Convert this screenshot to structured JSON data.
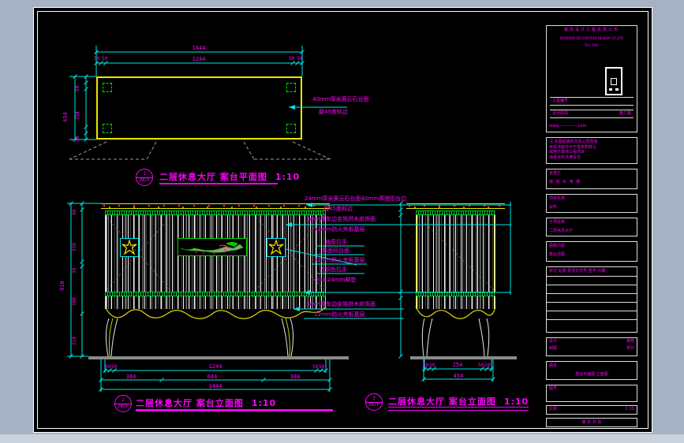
{
  "plan": {
    "bubble": {
      "number": "1",
      "floor": "2W/F"
    },
    "title": "二层休息大厅 案台平面图",
    "scale": "1:10",
    "dims": {
      "overall_w": "1444",
      "inner_w": "1244",
      "edge": "50",
      "overall_d": "454",
      "inner_d": "254"
    },
    "note_line1": "40mm厚米黄云石台面",
    "note_line2": "磨45度斜边"
  },
  "front": {
    "bubble": {
      "number": "2",
      "floor": "2W/F"
    },
    "title": "二层休息大厅 案台立面图",
    "scale": "1:10",
    "dims": {
      "row1_center": "1244",
      "edge": "50",
      "row2": [
        "384",
        "644",
        "384"
      ],
      "row3": "1444",
      "left": [
        "40",
        "330",
        "30",
        "300",
        "210"
      ],
      "left_overall": "910"
    },
    "annotations": [
      "24mm厚米黄云石台面40mm厚随形台边",
      "磨45度斜边",
      "3mm厚车边金箔拼木皮饰面",
      "12mm防火夹板基层",
      "抽屉拉手",
      "饰面同台面",
      "12mm防火夹板基层",
      "古铜色拉手",
      "24×24mm脚垫",
      "3mm厚车边金箔拼木皮饰面",
      "12mm防火夹板基层"
    ]
  },
  "side": {
    "bubble": {
      "number": "3",
      "floor": "2W/F"
    },
    "title": "二层休息大厅 案台立面图",
    "scale": "1:10",
    "dims": {
      "row1_center": "254",
      "edge": "50",
      "row2": "454"
    }
  },
  "title_block": {
    "company_cn": "装饰设计工程有限公司",
    "company_en": "INTERIOR DECORATION DESIGN CO.,LTD",
    "contact": "TEL:          FAX:",
    "field1_label": "工程编号",
    "field1_value": "",
    "field2_label": "设计阶段",
    "field2_value": "施工图",
    "website": "www.------------.com",
    "notes": [
      "注:本图纸版权归本公司所有",
      "未经书面许可不得复制转让",
      "或用于其他工程项目",
      "违者追究法律责任"
    ],
    "huiqian_label": "会签栏",
    "huiqian_cols": "建  结  水  电  暖",
    "project_label": "项目名称",
    "project_value": "会所",
    "sub_label": "子项名称",
    "sub_value": "二层休息大厅",
    "content_label": "图纸内容",
    "content_value": "案台详图",
    "rev_header": "标记 处数 更改文件号 签字 日期",
    "design_label": "设计",
    "check_label": "审核",
    "draw_label": "制图",
    "proof_label": "校对",
    "drawing_name_label": "图名",
    "drawing_name": "案台平面图 立面图",
    "drawing_no_label": "图号",
    "drawing_no": "",
    "scale_label": "比例",
    "scale_value": "1:10",
    "sheet": "第  张  共  张"
  }
}
